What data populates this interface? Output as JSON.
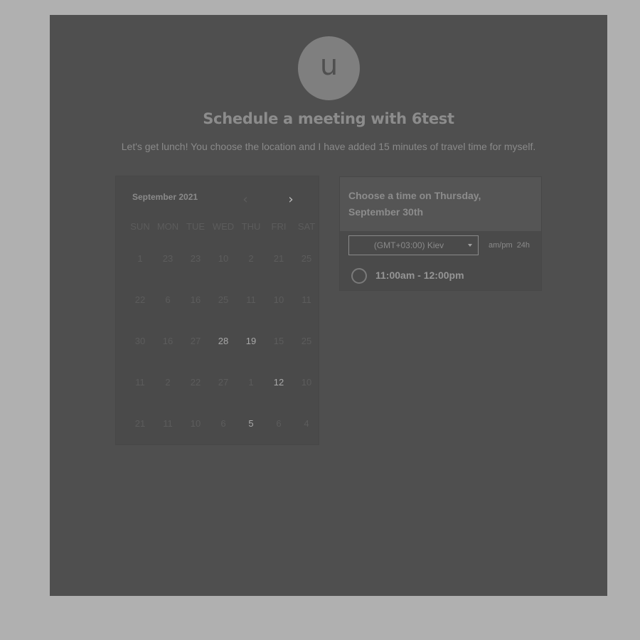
{
  "profile": {
    "avatar_letter": "u"
  },
  "header": {
    "title": "Schedule a meeting with 6test",
    "description": "Let's get lunch! You choose the location and I have added 15 minutes of travel time for myself."
  },
  "calendar": {
    "month_label": "September 2021",
    "prev_icon": "chevron-left-icon",
    "next_icon": "chevron-right-icon",
    "weekdays": [
      "SUN",
      "MON",
      "TUE",
      "WED",
      "THU",
      "FRI",
      "SAT"
    ],
    "weeks": [
      [
        "1",
        "23",
        "23",
        "10",
        "2",
        "21",
        "25"
      ],
      [
        "22",
        "6",
        "16",
        "25",
        "11",
        "10",
        "11"
      ],
      [
        "30",
        "16",
        "27",
        "28",
        "19",
        "15",
        "25"
      ],
      [
        "11",
        "2",
        "22",
        "27",
        "1",
        "12",
        "10"
      ],
      [
        "21",
        "11",
        "10",
        "6",
        "5",
        "6",
        "4"
      ]
    ],
    "available_days": [
      "28",
      "19",
      "12",
      "5"
    ]
  },
  "time_panel": {
    "heading": "Choose a time on Thursday, September 30th",
    "timezone": "(GMT+03:00) Kiev",
    "format_ampm": "am/pm",
    "format_24h": "24h",
    "slots": [
      "11:00am - 12:00pm"
    ]
  }
}
